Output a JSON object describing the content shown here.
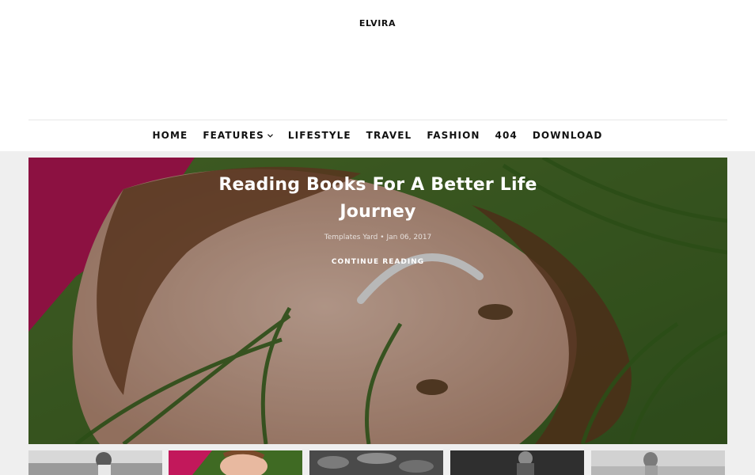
{
  "site": {
    "title": "ELVIRA"
  },
  "nav": {
    "items": [
      {
        "label": "HOME"
      },
      {
        "label": "FEATURES",
        "has_dropdown": true,
        "dropdown_icon": "chevron-down-icon"
      },
      {
        "label": "LIFESTYLE"
      },
      {
        "label": "TRAVEL"
      },
      {
        "label": "FASHION"
      },
      {
        "label": "404"
      },
      {
        "label": "DOWNLOAD"
      }
    ]
  },
  "hero": {
    "title": "Reading Books For A Better Life Journey",
    "author": "Templates Yard",
    "separator": "•",
    "date": "Jan 06, 2017",
    "cta": "CONTINUE READING",
    "image": "woman lying in grass smiling"
  },
  "thumbnails": [
    {
      "image": "grayscale woman by water"
    },
    {
      "image": "color woman in grass"
    },
    {
      "image": "grayscale leaves"
    },
    {
      "image": "grayscale person sitting"
    },
    {
      "image": "grayscale woman outdoors"
    }
  ],
  "colors": {
    "background": "#ffffff",
    "band": "#efefef",
    "text": "#111111",
    "hero_text": "#ffffff"
  }
}
